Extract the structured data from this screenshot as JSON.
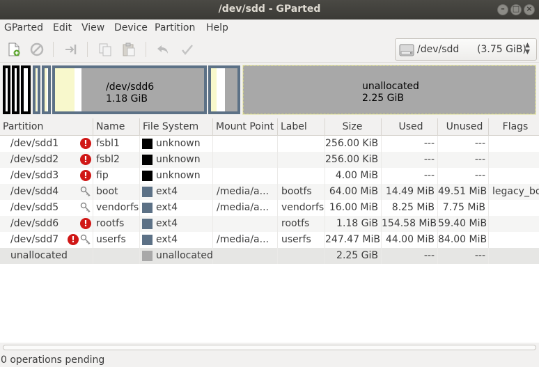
{
  "window": {
    "title": "/dev/sdd - GParted"
  },
  "menu": [
    "GParted",
    "Edit",
    "View",
    "Device",
    "Partition",
    "Help"
  ],
  "device": {
    "name": "/dev/sdd",
    "size": "(3.75 GiB)"
  },
  "diskmap": {
    "sdd6": {
      "name": "/dev/sdd6",
      "size": "1.18 GiB"
    },
    "unallocated": {
      "name": "unallocated",
      "size": "2.25 GiB"
    }
  },
  "columns": [
    "Partition",
    "Name",
    "File System",
    "Mount Point",
    "Label",
    "Size",
    "Used",
    "Unused",
    "Flags"
  ],
  "rows": [
    {
      "partition": "/dev/sdd1",
      "name": "fsbl1",
      "fs": "unknown",
      "mount": "",
      "label": "",
      "size": "256.00 KiB",
      "used": "---",
      "unused": "---",
      "flags": ""
    },
    {
      "partition": "/dev/sdd2",
      "name": "fsbl2",
      "fs": "unknown",
      "mount": "",
      "label": "",
      "size": "256.00 KiB",
      "used": "---",
      "unused": "---",
      "flags": ""
    },
    {
      "partition": "/dev/sdd3",
      "name": "fip",
      "fs": "unknown",
      "mount": "",
      "label": "",
      "size": "4.00 MiB",
      "used": "---",
      "unused": "---",
      "flags": ""
    },
    {
      "partition": "/dev/sdd4",
      "name": "boot",
      "fs": "ext4",
      "mount": "/media/a...",
      "label": "bootfs",
      "size": "64.00 MiB",
      "used": "14.49 MiB",
      "unused": "49.51 MiB",
      "flags": "legacy_bo"
    },
    {
      "partition": "/dev/sdd5",
      "name": "vendorfs",
      "fs": "ext4",
      "mount": "/media/a...",
      "label": "vendorfs",
      "size": "16.00 MiB",
      "used": "8.25 MiB",
      "unused": "7.75 MiB",
      "flags": ""
    },
    {
      "partition": "/dev/sdd6",
      "name": "rootfs",
      "fs": "ext4",
      "mount": "",
      "label": "rootfs",
      "size": "1.18 GiB",
      "used": "154.58 MiB",
      "unused": "59.40 MiB",
      "flags": ""
    },
    {
      "partition": "/dev/sdd7",
      "name": "userfs",
      "fs": "ext4",
      "mount": "/media/a...",
      "label": "userfs",
      "size": "247.47 MiB",
      "used": "44.00 MiB",
      "unused": "84.00 MiB",
      "flags": ""
    },
    {
      "partition": "unallocated",
      "name": "",
      "fs": "unallocated",
      "mount": "",
      "label": "",
      "size": "2.25 GiB",
      "used": "---",
      "unused": "---",
      "flags": ""
    }
  ],
  "colors": {
    "unknown": "#000000",
    "ext4": "#5c7186",
    "unallocated": "#a8a8a8",
    "used": "#f8f8cc",
    "warning": "#d01716"
  },
  "status": "0 operations pending"
}
